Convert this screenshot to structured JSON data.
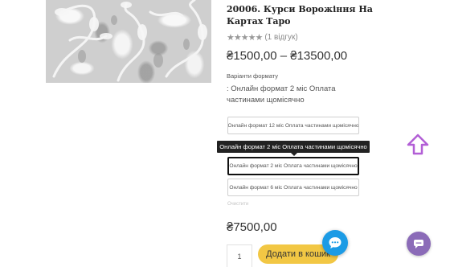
{
  "product": {
    "title": "20006. Курси Ворожіння На Картах Таро",
    "rating": {
      "stars": "★★★★★",
      "reviews": "(1 відгук)",
      "value": 5,
      "max": 5
    },
    "price_range": "₴1500,00 – ₴13500,00",
    "variants_label": "Варіанти формату",
    "selected_variant_text": ": Онлайн формат 2 міс Оплата частинами щомісячно",
    "options": [
      "Онлайн формат 12 міс Оплата частинами щомісячно",
      "Онлайн формат 2 міс Оплата частинами щомісячно",
      "Онлайн формат 6 міс Оплата частинами щомісячно"
    ],
    "tooltip": "Онлайн формат 2 міс Оплата частинами щомісячно",
    "clear_label": "Очистити",
    "price": "₴7500,00",
    "quantity": "1",
    "add_to_cart_label": "Додати в кошик"
  },
  "widgets": {
    "chat_icon": "chat-bubble-icon",
    "messenger_icon": "message-icon",
    "scroll_icon": "arrow-up-icon",
    "accent_colors": {
      "chat": "#1c9be5",
      "messenger": "#8b6bb8",
      "scroll": "#b25fd6",
      "button": "#f2c744"
    }
  }
}
